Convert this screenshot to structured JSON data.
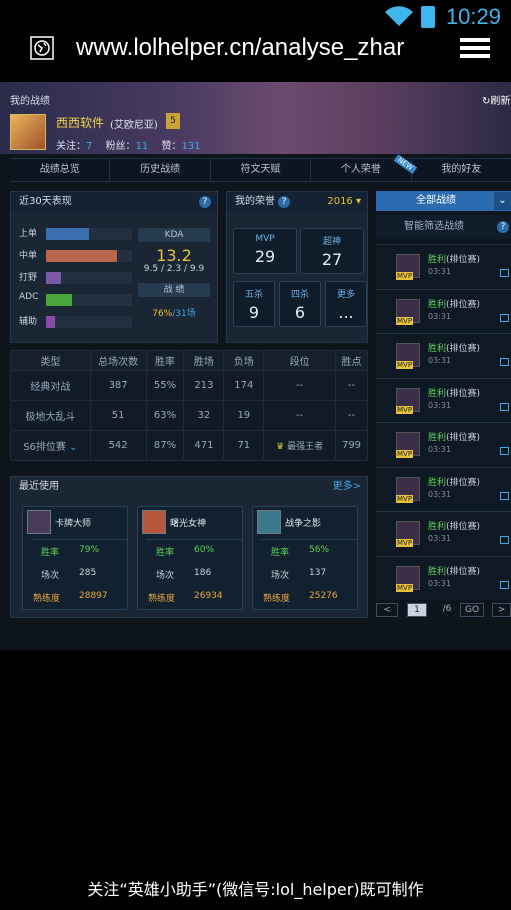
{
  "status": {
    "time": "10:29"
  },
  "browser": {
    "url": "www.lolhelper.cn/analyse_zhar"
  },
  "header": {
    "section": "我的战绩",
    "refresh": "刷新",
    "name": "西西软件",
    "server": "(艾欧尼亚)",
    "rank_badge": "5",
    "follow_label": "关注：",
    "follow": "7",
    "fans_label": "粉丝：",
    "fans": "11",
    "like_label": "赞：",
    "like": "131"
  },
  "tabs": [
    "战绩总览",
    "历史战绩",
    "符文天赋",
    "个人荣誉",
    "我的好友"
  ],
  "tab_badge": "NEW",
  "perf": {
    "title": "近30天表现",
    "roles": [
      {
        "name": "上单",
        "value": 0.5,
        "color": "#3a6fb0"
      },
      {
        "name": "中单",
        "value": 0.82,
        "color": "#b8674a"
      },
      {
        "name": "打野",
        "value": 0.18,
        "color": "#7a5aa8"
      },
      {
        "name": "ADC",
        "value": 0.3,
        "color": "#4aa63a"
      },
      {
        "name": "辅助",
        "value": 0.1,
        "color": "#8a4aa8"
      }
    ],
    "kda_label": "KDA",
    "kda": "13.2",
    "kda_detail": "9.5 / 2.3 / 9.9",
    "record_label": "战 绩",
    "record_rate": "76%",
    "record_games": "/31场"
  },
  "honor": {
    "title": "我的荣誉",
    "year": "2016",
    "items": [
      {
        "t": "MVP",
        "v": "29"
      },
      {
        "t": "超神",
        "v": "27"
      },
      {
        "t": "五杀",
        "v": "9"
      },
      {
        "t": "四杀",
        "v": "6"
      },
      {
        "t": "更多",
        "v": "..."
      }
    ]
  },
  "stats": {
    "headers": [
      "类型",
      "总场次数",
      "胜率",
      "胜场",
      "负场",
      "段位",
      "胜点"
    ],
    "rows": [
      [
        "经典对战",
        "387",
        "55%",
        "213",
        "174",
        "--",
        "--"
      ],
      [
        "极地大乱斗",
        "51",
        "63%",
        "32",
        "19",
        "--",
        "--"
      ],
      [
        "S6排位赛",
        "542",
        "87%",
        "471",
        "71",
        "最强王者",
        "799"
      ]
    ]
  },
  "recent": {
    "title": "最近使用",
    "more": "更多",
    "cards": [
      {
        "name": "卡牌大师",
        "rate": "79%",
        "games": "285",
        "mastery": "28897"
      },
      {
        "name": "曙光女神",
        "rate": "60%",
        "games": "186",
        "mastery": "26934"
      },
      {
        "name": "战争之影",
        "rate": "56%",
        "games": "137",
        "mastery": "25276"
      }
    ],
    "labels": {
      "rate": "胜率",
      "games": "场次",
      "mastery": "熟练度"
    }
  },
  "matches": {
    "filter_all": "全部战绩",
    "filter_smart": "智能筛选战绩",
    "items": [
      {
        "result": "胜利",
        "mode": "(排位赛)",
        "time": "03:31"
      },
      {
        "result": "胜利",
        "mode": "(排位赛)",
        "time": "03:31"
      },
      {
        "result": "胜利",
        "mode": "(排位赛)",
        "time": "03:31"
      },
      {
        "result": "胜利",
        "mode": "(排位赛)",
        "time": "03:31"
      },
      {
        "result": "胜利",
        "mode": "(排位赛)",
        "time": "03:31"
      },
      {
        "result": "胜利",
        "mode": "(排位赛)",
        "time": "03:31"
      },
      {
        "result": "胜利",
        "mode": "(排位赛)",
        "time": "03:31"
      },
      {
        "result": "胜利",
        "mode": "(排位赛)",
        "time": "03:31"
      }
    ],
    "mvp": "MVP"
  },
  "pager": {
    "prev": "<",
    "page": "1",
    "total": "/6",
    "go": "GO",
    "next": ">"
  },
  "footer": "关注“英雄小助手”(微信号:lol_helper)既可制作"
}
